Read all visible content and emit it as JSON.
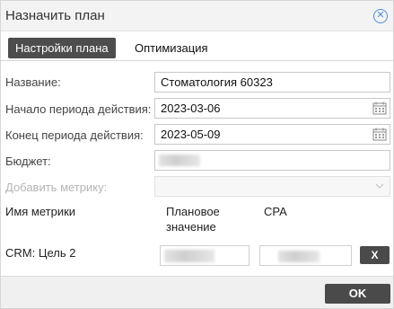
{
  "dialog": {
    "title": "Назначить план"
  },
  "tabs": [
    {
      "label": "Настройки плана",
      "active": true
    },
    {
      "label": "Оптимизация",
      "active": false
    }
  ],
  "form": {
    "name": {
      "label": "Название:",
      "value": "Стоматология 60323"
    },
    "start": {
      "label": "Начало периода действия:",
      "value": "2023-03-06"
    },
    "end": {
      "label": "Конец периода действия:",
      "value": "2023-05-09"
    },
    "budget": {
      "label": "Бюджет:"
    },
    "add_metric": {
      "label": "Добавить метрику:"
    }
  },
  "metrics_table": {
    "col_name": "Имя метрики",
    "col_plan_line1": "Плановое",
    "col_plan_line2": "значение",
    "col_cpa": "CPA",
    "rows": [
      {
        "name": "CRM: Цель 2"
      }
    ],
    "remove_label": "X"
  },
  "footer": {
    "ok_label": "OK"
  },
  "colors": {
    "accent": "#4d8fd8",
    "button_dark": "#4a4a4a"
  }
}
